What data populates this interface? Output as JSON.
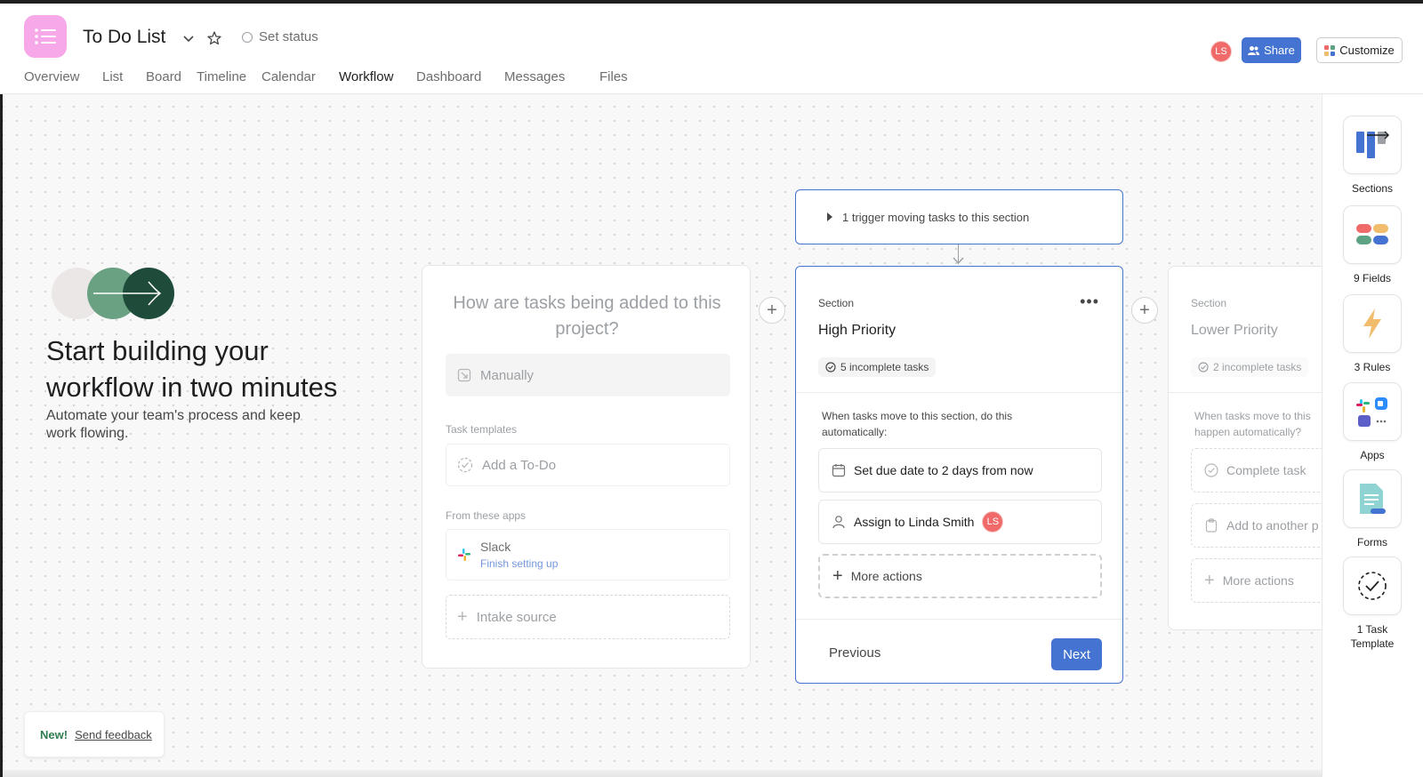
{
  "project": {
    "title": "To Do List",
    "set_status": "Set status",
    "icon": "list-icon",
    "icon_color": "#f7a8e8"
  },
  "tabs": [
    {
      "label": "Overview"
    },
    {
      "label": "List"
    },
    {
      "label": "Board"
    },
    {
      "label": "Timeline"
    },
    {
      "label": "Calendar"
    },
    {
      "label": "Workflow",
      "active": true
    },
    {
      "label": "Dashboard"
    },
    {
      "label": "Messages"
    },
    {
      "label": "Files"
    }
  ],
  "header_actions": {
    "avatar_initials": "LS",
    "share_label": "Share",
    "customize_label": "Customize",
    "accent": "#4573d2"
  },
  "intro": {
    "headline": "Start building your workflow in two minutes",
    "subtext": "Automate your team's process and keep work flowing."
  },
  "intake_card": {
    "question": "How are tasks being added to this project?",
    "manually": "Manually",
    "templates_header": "Task templates",
    "add_todo": "Add a To-Do",
    "apps_header": "From these apps",
    "slack_name": "Slack",
    "slack_status": "Finish setting up",
    "intake_source": "Intake source"
  },
  "trigger": {
    "label": "1 trigger moving tasks to this section"
  },
  "section_card": {
    "section_label": "Section",
    "name": "High Priority",
    "incomplete": "5 incomplete tasks",
    "when_text": "When tasks move to this section, do this automatically:",
    "action_due": "Set due date to 2 days from now",
    "action_assign": "Assign to Linda Smith",
    "assignee_initials": "LS",
    "more_actions": "More actions",
    "previous": "Previous",
    "next": "Next"
  },
  "next_card": {
    "section_label": "Section",
    "name": "Lower Priority",
    "incomplete": "2 incomplete tasks",
    "when_text": "When tasks move to this happen automatically?",
    "complete_task": "Complete task",
    "add_to_another": "Add to another p",
    "more_actions": "More actions"
  },
  "feedback": {
    "new_label": "New!",
    "link": "Send feedback",
    "new_color": "#2f7d50"
  },
  "right_panel": [
    {
      "label": "Sections",
      "icon": "sections-icon"
    },
    {
      "label": "9 Fields",
      "icon": "fields-icon"
    },
    {
      "label": "3 Rules",
      "icon": "lightning-icon"
    },
    {
      "label": "Apps",
      "icon": "apps-icon"
    },
    {
      "label": "Forms",
      "icon": "forms-icon"
    },
    {
      "label": "1 Task Template",
      "icon": "task-template-icon"
    }
  ]
}
